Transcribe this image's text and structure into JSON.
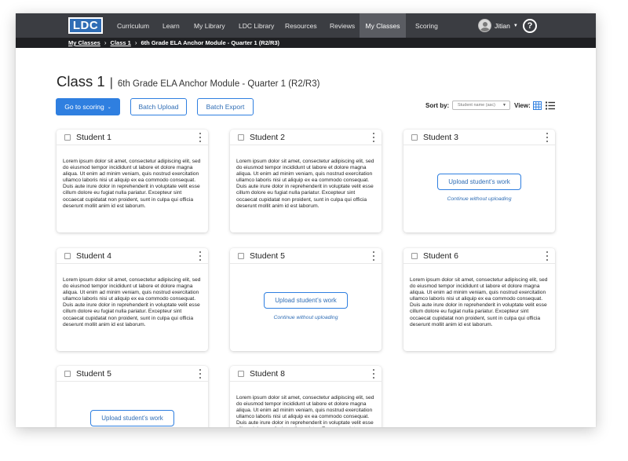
{
  "nav": {
    "logo": "LDC",
    "items": [
      "Curriculum",
      "Learn",
      "My Library",
      "LDC Library",
      "Resources",
      "Reviews",
      "My Classes",
      "Scoring"
    ],
    "active": "My Classes",
    "user": "Jitian",
    "help": "?"
  },
  "breadcrumb": {
    "items": [
      "My Classes",
      "Class 1"
    ],
    "current": "6th Grade ELA Anchor Module - Quarter 1 (R2/R3)",
    "separator": "›"
  },
  "header": {
    "title": "Class 1",
    "divider": "|",
    "subtitle": "6th Grade ELA Anchor Module - Quarter 1 (R2/R3)"
  },
  "toolbar": {
    "goto_label": "Go to scoring",
    "batch_upload": "Batch Upload",
    "batch_export": "Batch Export",
    "sort_label": "Sort by:",
    "sort_value": "Student name (asc)",
    "view_label": "View:"
  },
  "lorem": "Lorem ipsum dolor sit amet, consectetur adipiscing elit, sed do eiusmod tempor incididunt ut labore et dolore magna aliqua. Ut enim ad minim veniam, quis nostrud exercitation ullamco laboris nisi ut aliquip ex ea commodo consequat. Duis aute irure dolor in reprehenderit in voluptate velit esse cillum dolore eu fugiat nulla pariatur. Excepteur sint occaecat cupidatat non proident, sunt in culpa qui officia deserunt mollit anim id est laborum.",
  "upload_label": "Upload student’s work",
  "continue_label": "Continue without uploading",
  "cards": [
    {
      "name": "Student 1",
      "state": "text",
      "text": "Lorem ipsum dolor sit amet, consectetur adipiscing elit, sed do eiusmod tempor incididunt ut labore et dolore magna aliqua. Ut enim ad minim veniam, quis nostrud exercitation ullamco laboris nisi ut aliquip ex ea commodo consequat. Duis aute irure dolor in reprehenderit in voluptate velit esse cillum dolore eu fugiat nulla pariatur. Excepteur sint occaecat cupidatat non proident, sunt in culpa qui officia deserunt mollit anim id est laborum."
    },
    {
      "name": "Student 2",
      "state": "text",
      "text": "Lorem ipsum dolor sit amet, consectetur adipiscing elit, sed do eiusmod tempor incididunt ut labore et dolore magna aliqua. Ut enim ad minim veniam, quis nostrud exercitation ullamco laboris nisi ut aliquip ex ea commodo consequat. Duis aute irure dolor in reprehenderit in voluptate velit esse cillum dolore eu fugiat nulla pariatur. Excepteur sint occaecat cupidatat non proident, sunt in culpa qui officia deserunt mollit anim id est laborum."
    },
    {
      "name": "Student 3",
      "state": "upload"
    },
    {
      "name": "Student 4",
      "state": "text",
      "text": "Lorem ipsum dolor sit amet, consectetur adipiscing elit, sed do eiusmod tempor incididunt ut labore et dolore magna aliqua. Ut enim ad minim veniam, quis nostrud exercitation ullamco laboris nisi ut aliquip ex ea commodo consequat. Duis aute irure dolor in reprehenderit in voluptate velit esse cillum dolore eu fugiat nulla pariatur. Excepteur sint occaecat cupidatat non proident, sunt in culpa qui officia deserunt mollit anim id est laborum."
    },
    {
      "name": "Student 5",
      "state": "upload"
    },
    {
      "name": "Student 6",
      "state": "text",
      "text": "Lorem ipsum dolor sit amet, consectetur adipiscing elit, sed do eiusmod tempor incididunt ut labore et dolore magna aliqua. Ut enim ad minim veniam, quis nostrud exercitation ullamco laboris nisi ut aliquip ex ea commodo consequat. Duis aute irure dolor in reprehenderit in voluptate velit esse cillum dolore eu fugiat nulla pariatur. Excepteur sint occaecat cupidatat non proident, sunt in culpa qui officia deserunt mollit anim id est laborum."
    },
    {
      "name": "Student 5",
      "state": "upload"
    },
    {
      "name": "Student 8",
      "state": "text",
      "text": "Lorem ipsum dolor sit amet, consectetur adipiscing elit, sed do eiusmod tempor incididunt ut labore et dolore magna aliqua. Ut enim ad minim veniam, quis nostrud exercitation ullamco laboris nisi ut aliquip ex ea commodo consequat. Duis aute irure dolor in reprehenderit in voluptate velit esse cillum dolore eu fugiat nulla pariatur. Excepteur sint occaecat cupidatat non proident, sunt in culpa qui officia deserunt mollit anim id est laborum."
    }
  ],
  "colors": {
    "nav_bg": "#3b3d42",
    "breadcrumb_bg": "#1e1f22",
    "accent": "#2f7fe0",
    "link": "#2f6db5"
  }
}
